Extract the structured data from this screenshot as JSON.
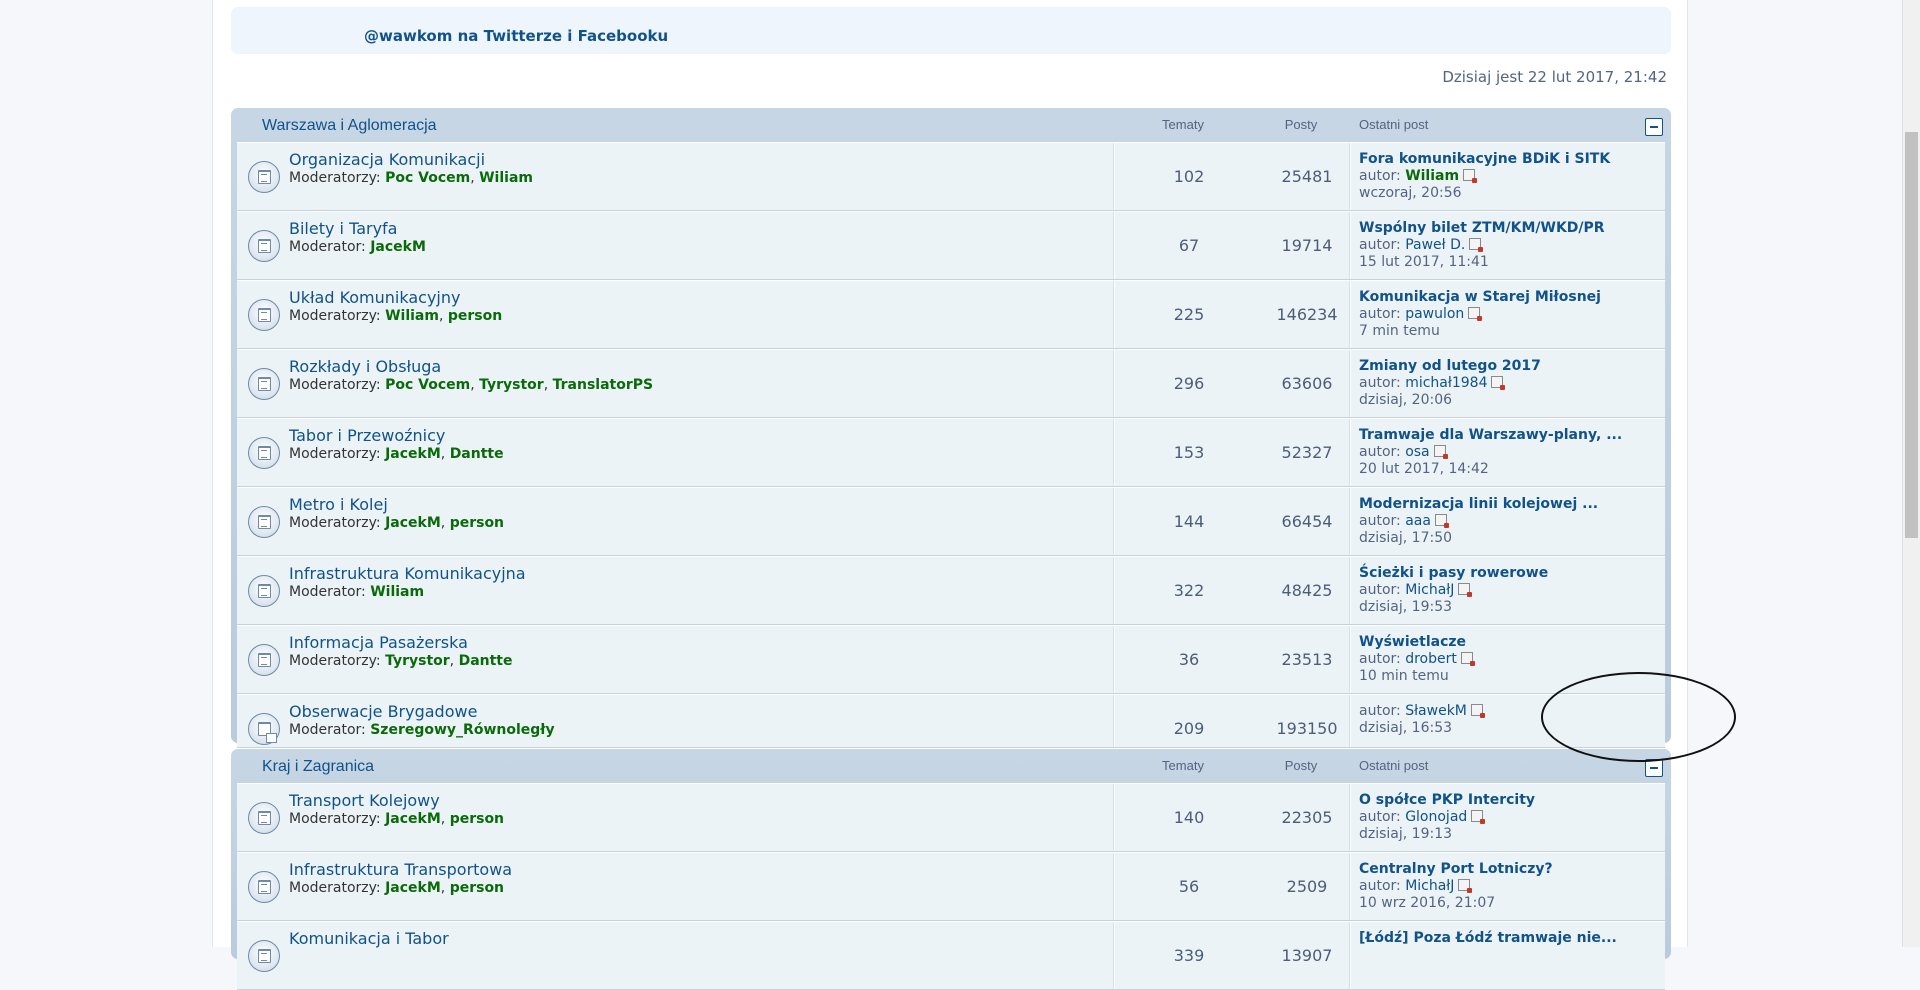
{
  "header": {
    "social_handle": "@wawkom",
    "social_mid": " na ",
    "social_twitter": "Twitterze",
    "social_and": " i ",
    "social_facebook": "Facebooku",
    "datetime": "Dzisiaj jest 22 lut 2017, 21:42"
  },
  "columns": {
    "topics": "Tematy",
    "posts": "Posty",
    "last_post": "Ostatni post"
  },
  "categories": [
    {
      "title": "Warszawa i Aglomeracja",
      "forums": [
        {
          "title": "Organizacja Komunikacji",
          "mod_label": "Moderatorzy:",
          "mods": [
            "Poc Vocem",
            "Wiliam"
          ],
          "topics": "102",
          "posts": "25481",
          "last_title": "Fora komunikacyjne BDiK i SITK",
          "author_label": "autor:",
          "author": "Wiliam",
          "author_green": true,
          "time": "wczoraj, 20:56"
        },
        {
          "title": "Bilety i Taryfa",
          "mod_label": "Moderator:",
          "mods": [
            "JacekM"
          ],
          "topics": "67",
          "posts": "19714",
          "last_title": "Wspólny bilet ZTM/KM/WKD/PR",
          "author_label": "autor:",
          "author": "Paweł D.",
          "author_green": false,
          "time": "15 lut 2017, 11:41"
        },
        {
          "title": "Układ Komunikacyjny",
          "mod_label": "Moderatorzy:",
          "mods": [
            "Wiliam",
            "person"
          ],
          "topics": "225",
          "posts": "146234",
          "last_title": "Komunikacja w Starej Miłosnej",
          "author_label": "autor:",
          "author": "pawulon",
          "author_green": false,
          "time": "7 min temu"
        },
        {
          "title": "Rozkłady i Obsługa",
          "mod_label": "Moderatorzy:",
          "mods": [
            "Poc Vocem",
            "Tyrystor",
            "TranslatorPS"
          ],
          "topics": "296",
          "posts": "63606",
          "last_title": "Zmiany od lutego 2017",
          "author_label": "autor:",
          "author": "michał1984",
          "author_green": false,
          "time": "dzisiaj, 20:06"
        },
        {
          "title": "Tabor i Przewoźnicy",
          "mod_label": "Moderatorzy:",
          "mods": [
            "JacekM",
            "Dantte"
          ],
          "topics": "153",
          "posts": "52327",
          "last_title": "Tramwaje dla Warszawy-plany, ...",
          "author_label": "autor:",
          "author": "osa",
          "author_green": false,
          "time": "20 lut 2017, 14:42"
        },
        {
          "title": "Metro i Kolej",
          "mod_label": "Moderatorzy:",
          "mods": [
            "JacekM",
            "person"
          ],
          "topics": "144",
          "posts": "66454",
          "last_title": "Modernizacja linii kolejowej ...",
          "author_label": "autor:",
          "author": "aaa",
          "author_green": false,
          "time": "dzisiaj, 17:50"
        },
        {
          "title": "Infrastruktura Komunikacyjna",
          "mod_label": "Moderator:",
          "mods": [
            "Wiliam"
          ],
          "topics": "322",
          "posts": "48425",
          "last_title": "Ścieżki i pasy rowerowe",
          "author_label": "autor:",
          "author": "MichałJ",
          "author_green": false,
          "time": "dzisiaj, 19:53"
        },
        {
          "title": "Informacja Pasażerska",
          "mod_label": "Moderatorzy:",
          "mods": [
            "Tyrystor",
            "Dantte"
          ],
          "topics": "36",
          "posts": "23513",
          "last_title": "Wyświetlacze",
          "author_label": "autor:",
          "author": "drobert",
          "author_green": false,
          "time": "10 min temu"
        },
        {
          "title": "Obserwacje Brygadowe",
          "mod_label": "Moderator:",
          "mods": [
            "Szeregowy_Równoległy"
          ],
          "topics": "209",
          "posts": "193150",
          "last_title": "",
          "author_label": "autor:",
          "author": "SławekM",
          "author_green": false,
          "time": "dzisiaj, 16:53"
        }
      ]
    },
    {
      "title": "Kraj i Zagranica",
      "forums": [
        {
          "title": "Transport Kolejowy",
          "mod_label": "Moderatorzy:",
          "mods": [
            "JacekM",
            "person"
          ],
          "topics": "140",
          "posts": "22305",
          "last_title": "O spółce PKP Intercity",
          "author_label": "autor:",
          "author": "Glonojad",
          "author_green": false,
          "time": "dzisiaj, 19:13"
        },
        {
          "title": "Infrastruktura Transportowa",
          "mod_label": "Moderatorzy:",
          "mods": [
            "JacekM",
            "person"
          ],
          "topics": "56",
          "posts": "2509",
          "last_title": "Centralny Port Lotniczy?",
          "author_label": "autor:",
          "author": "MichałJ",
          "author_green": false,
          "time": "10 wrz 2016, 21:07"
        },
        {
          "title": "Komunikacja i Tabor",
          "mod_label": "",
          "mods": [],
          "topics": "339",
          "posts": "13907",
          "last_title": "[Łódź] Poza Łódź tramwaje nie...",
          "author_label": "",
          "author": "",
          "author_green": false,
          "time": ""
        }
      ]
    }
  ]
}
